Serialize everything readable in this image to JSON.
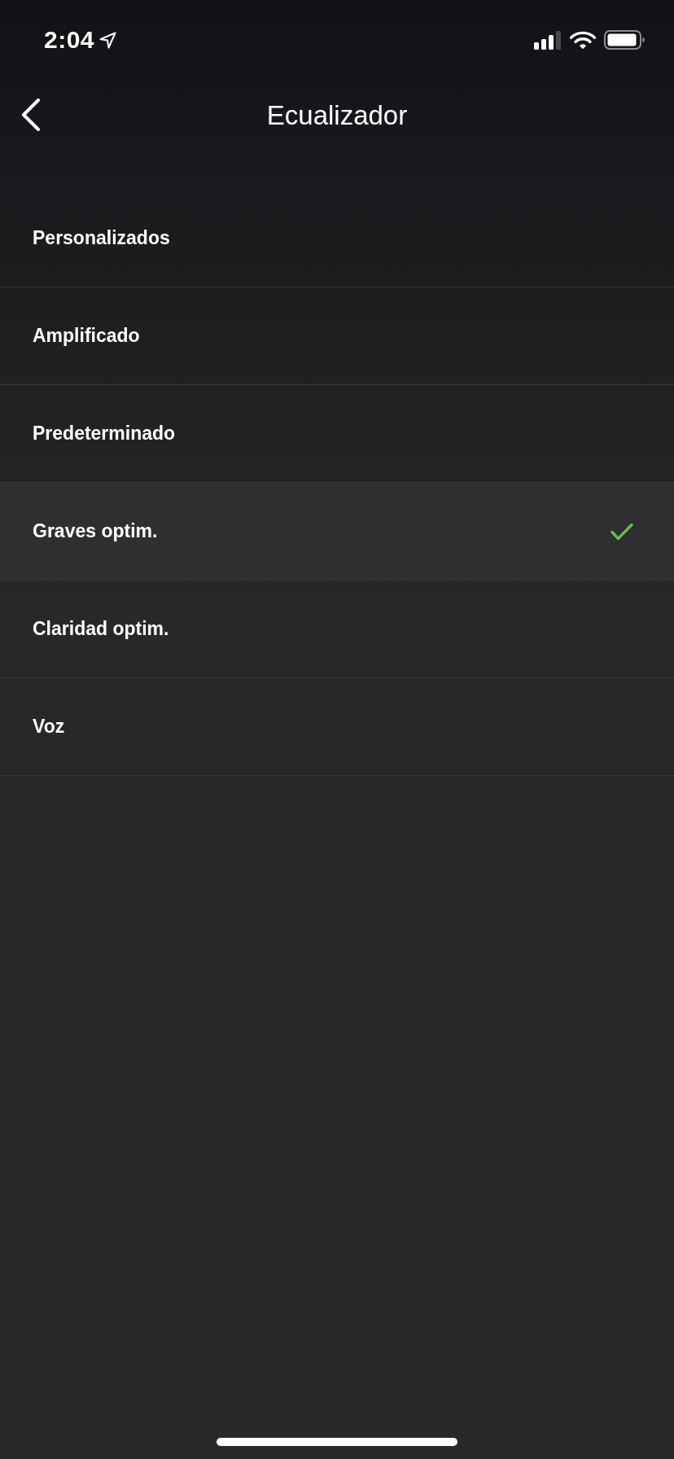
{
  "status_bar": {
    "time": "2:04"
  },
  "nav_bar": {
    "title": "Ecualizador"
  },
  "presets": [
    {
      "label": "Personalizados",
      "selected": false
    },
    {
      "label": "Amplificado",
      "selected": false
    },
    {
      "label": "Predeterminado",
      "selected": false
    },
    {
      "label": "Graves optim.",
      "selected": true
    },
    {
      "label": "Claridad optim.",
      "selected": false
    },
    {
      "label": "Voz",
      "selected": false
    }
  ]
}
